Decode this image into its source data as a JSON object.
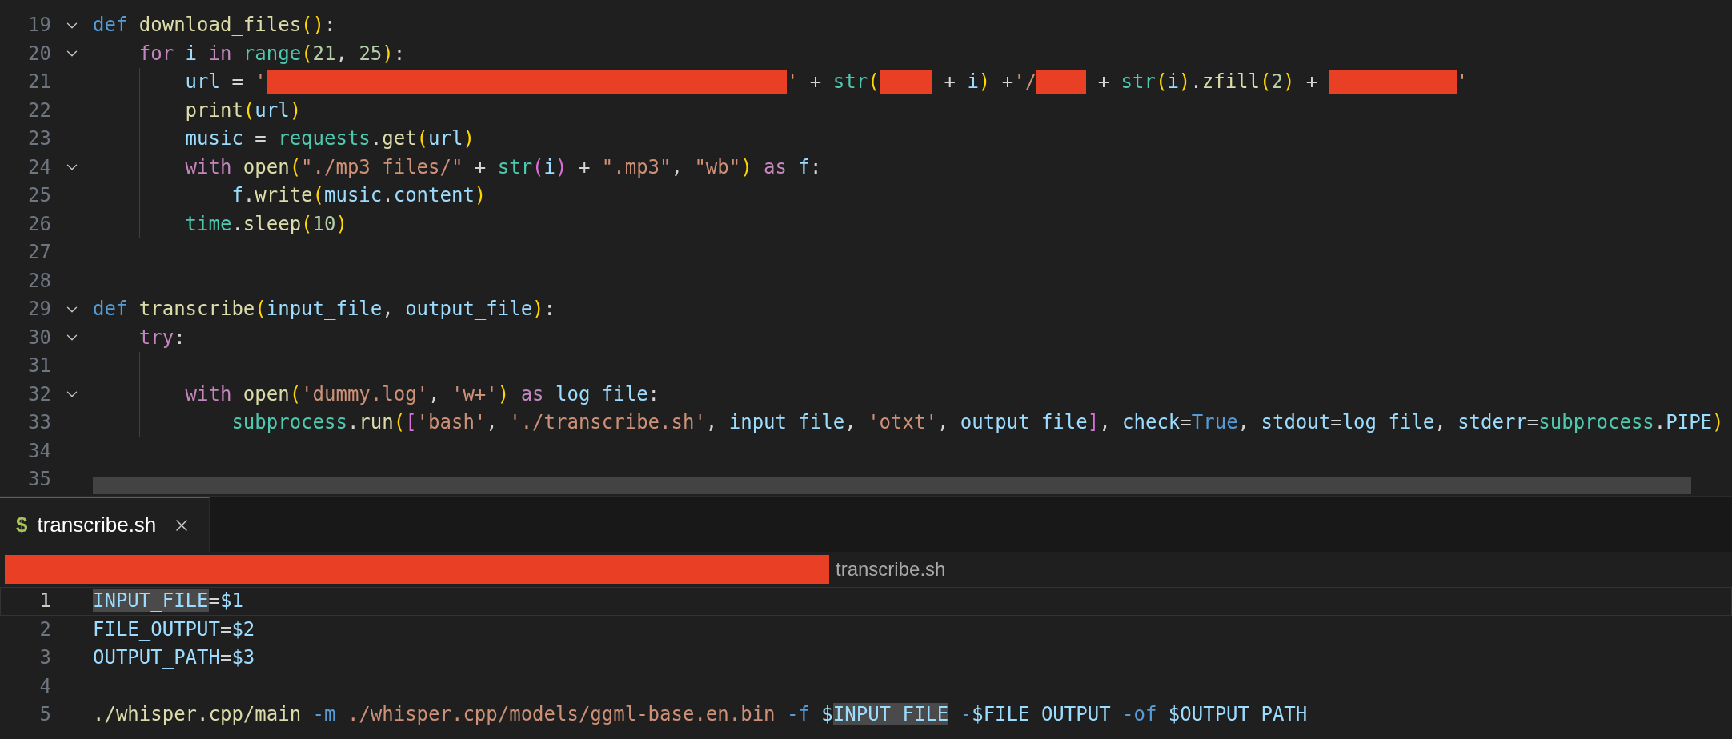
{
  "editor": {
    "lines": [
      {
        "n": "19",
        "fold": true,
        "current": false,
        "tokens": [
          {
            "kind": "storage",
            "text": "def"
          },
          {
            "kind": "function",
            "text": " download_files"
          },
          {
            "kind": "bracket1",
            "text": "()"
          },
          {
            "kind": "plain",
            "text": ":"
          }
        ],
        "children": [
          {
            "n": "20",
            "fold": true,
            "current": false,
            "tokens": [
              {
                "kind": "keyword",
                "text": "for"
              },
              {
                "kind": "variable",
                "text": " i"
              },
              {
                "kind": "keyword",
                "text": " in"
              },
              {
                "kind": "builtin",
                "text": " range"
              },
              {
                "kind": "bracket1",
                "text": "("
              },
              {
                "kind": "number",
                "text": "21"
              },
              {
                "kind": "plain",
                "text": ","
              },
              {
                "kind": "number",
                "text": " 25"
              },
              {
                "kind": "bracket1",
                "text": ")"
              },
              {
                "kind": "plain",
                "text": ":"
              }
            ],
            "children": [
              {
                "n": "21",
                "fold": false,
                "current": false,
                "tokens": [
                  {
                    "kind": "variable",
                    "text": "url"
                  },
                  {
                    "kind": "plain",
                    "text": " ="
                  },
                  {
                    "kind": "string",
                    "text": " '"
                  },
                  {
                    "kind": "redacted"
                  },
                  {
                    "kind": "string",
                    "text": "'"
                  },
                  {
                    "kind": "plain",
                    "text": " +"
                  },
                  {
                    "kind": "builtin",
                    "text": " str"
                  },
                  {
                    "kind": "bracket1",
                    "text": "("
                  },
                  {
                    "kind": "redacted"
                  },
                  {
                    "kind": "plain",
                    "text": " +"
                  },
                  {
                    "kind": "variable",
                    "text": " i"
                  },
                  {
                    "kind": "bracket1",
                    "text": ")"
                  },
                  {
                    "kind": "plain",
                    "text": " +"
                  },
                  {
                    "kind": "string",
                    "text": "'/"
                  },
                  {
                    "kind": "redacted"
                  },
                  {
                    "kind": "plain",
                    "text": " +"
                  },
                  {
                    "kind": "builtin",
                    "text": " str"
                  },
                  {
                    "kind": "bracket1",
                    "text": "("
                  },
                  {
                    "kind": "variable",
                    "text": "i"
                  },
                  {
                    "kind": "bracket1",
                    "text": ")"
                  },
                  {
                    "kind": "plain",
                    "text": "."
                  },
                  {
                    "kind": "function",
                    "text": "zfill"
                  },
                  {
                    "kind": "bracket1",
                    "text": "("
                  },
                  {
                    "kind": "number",
                    "text": "2"
                  },
                  {
                    "kind": "bracket1",
                    "text": ")"
                  },
                  {
                    "kind": "plain",
                    "text": " + "
                  },
                  {
                    "kind": "redacted"
                  },
                  {
                    "kind": "string",
                    "text": "'"
                  }
                ]
              },
              {
                "n": "22",
                "fold": false,
                "current": false,
                "tokens": [
                  {
                    "kind": "function",
                    "text": "print"
                  },
                  {
                    "kind": "bracket1",
                    "text": "("
                  },
                  {
                    "kind": "variable",
                    "text": "url"
                  },
                  {
                    "kind": "bracket1",
                    "text": ")"
                  }
                ]
              },
              {
                "n": "23",
                "fold": false,
                "current": false,
                "tokens": [
                  {
                    "kind": "variable",
                    "text": "music"
                  },
                  {
                    "kind": "plain",
                    "text": " ="
                  },
                  {
                    "kind": "builtin",
                    "text": " requests"
                  },
                  {
                    "kind": "plain",
                    "text": "."
                  },
                  {
                    "kind": "function",
                    "text": "get"
                  },
                  {
                    "kind": "bracket1",
                    "text": "("
                  },
                  {
                    "kind": "variable",
                    "text": "url"
                  },
                  {
                    "kind": "bracket1",
                    "text": ")"
                  }
                ]
              },
              {
                "n": "24",
                "fold": true,
                "current": false,
                "tokens": [
                  {
                    "kind": "keyword",
                    "text": "with"
                  },
                  {
                    "kind": "function",
                    "text": " open"
                  },
                  {
                    "kind": "bracket1",
                    "text": "("
                  },
                  {
                    "kind": "string",
                    "text": "\"./mp3_files/\""
                  },
                  {
                    "kind": "plain",
                    "text": " +"
                  },
                  {
                    "kind": "builtin",
                    "text": " str"
                  },
                  {
                    "kind": "bracket2",
                    "text": "("
                  },
                  {
                    "kind": "variable",
                    "text": "i"
                  },
                  {
                    "kind": "bracket2",
                    "text": ")"
                  },
                  {
                    "kind": "plain",
                    "text": " +"
                  },
                  {
                    "kind": "string",
                    "text": " \".mp3\""
                  },
                  {
                    "kind": "plain",
                    "text": ","
                  },
                  {
                    "kind": "string",
                    "text": " \"wb\""
                  },
                  {
                    "kind": "bracket1",
                    "text": ")"
                  },
                  {
                    "kind": "keyword",
                    "text": " as"
                  },
                  {
                    "kind": "variable",
                    "text": " f"
                  },
                  {
                    "kind": "plain",
                    "text": ":"
                  }
                ],
                "children": [
                  {
                    "n": "25",
                    "fold": false,
                    "current": false,
                    "tokens": [
                      {
                        "kind": "variable",
                        "text": "f"
                      },
                      {
                        "kind": "plain",
                        "text": "."
                      },
                      {
                        "kind": "function",
                        "text": "write"
                      },
                      {
                        "kind": "bracket1",
                        "text": "("
                      },
                      {
                        "kind": "variable",
                        "text": "music"
                      },
                      {
                        "kind": "plain",
                        "text": "."
                      },
                      {
                        "kind": "variable",
                        "text": "content"
                      },
                      {
                        "kind": "bracket1",
                        "text": ")"
                      }
                    ]
                  }
                ]
              },
              {
                "n": "26",
                "fold": false,
                "current": false,
                "tokens": [
                  {
                    "kind": "builtin",
                    "text": "time"
                  },
                  {
                    "kind": "plain",
                    "text": "."
                  },
                  {
                    "kind": "function",
                    "text": "sleep"
                  },
                  {
                    "kind": "bracket1",
                    "text": "("
                  },
                  {
                    "kind": "number",
                    "text": "10"
                  },
                  {
                    "kind": "bracket1",
                    "text": ")"
                  }
                ]
              }
            ]
          }
        ]
      },
      {
        "n": "27",
        "fold": false,
        "current": false
      },
      {
        "n": "28",
        "fold": false,
        "current": false
      },
      {
        "n": "29",
        "fold": true,
        "current": false,
        "tokens": [
          {
            "kind": "storage",
            "text": "def"
          },
          {
            "kind": "function",
            "text": " transcribe"
          },
          {
            "kind": "bracket1",
            "text": "("
          },
          {
            "kind": "variable",
            "text": "input_file"
          },
          {
            "kind": "plain",
            "text": ","
          },
          {
            "kind": "variable",
            "text": " output_file"
          },
          {
            "kind": "bracket1",
            "text": ")"
          },
          {
            "kind": "plain",
            "text": ":"
          }
        ],
        "children": [
          {
            "n": "30",
            "fold": true,
            "current": false,
            "tokens": [
              {
                "kind": "keyword",
                "text": "try"
              },
              {
                "kind": "plain",
                "text": ":"
              }
            ],
            "children": [
              {
                "n": "31",
                "fold": false,
                "current": false
              },
              {
                "n": "32",
                "fold": true,
                "current": false,
                "tokens": [
                  {
                    "kind": "keyword",
                    "text": "with"
                  },
                  {
                    "kind": "function",
                    "text": " open"
                  },
                  {
                    "kind": "bracket1",
                    "text": "("
                  },
                  {
                    "kind": "string",
                    "text": "'dummy.log'"
                  },
                  {
                    "kind": "plain",
                    "text": ","
                  },
                  {
                    "kind": "string",
                    "text": " 'w+'"
                  },
                  {
                    "kind": "bracket1",
                    "text": ")"
                  },
                  {
                    "kind": "keyword",
                    "text": " as"
                  },
                  {
                    "kind": "variable",
                    "text": " log_file"
                  },
                  {
                    "kind": "plain",
                    "text": ":"
                  }
                ],
                "children": [
                  {
                    "n": "33",
                    "fold": false,
                    "current": false,
                    "tokens": [
                      {
                        "kind": "builtin",
                        "text": "subprocess"
                      },
                      {
                        "kind": "plain",
                        "text": "."
                      },
                      {
                        "kind": "function",
                        "text": "run"
                      },
                      {
                        "kind": "bracket1",
                        "text": "("
                      },
                      {
                        "kind": "bracket2",
                        "text": "["
                      },
                      {
                        "kind": "string",
                        "text": "'bash'"
                      },
                      {
                        "kind": "plain",
                        "text": ","
                      },
                      {
                        "kind": "string",
                        "text": " './transcribe.sh'"
                      },
                      {
                        "kind": "plain",
                        "text": ","
                      },
                      {
                        "kind": "variable",
                        "text": " input_file"
                      },
                      {
                        "kind": "plain",
                        "text": ","
                      },
                      {
                        "kind": "string",
                        "text": " 'otxt'"
                      },
                      {
                        "kind": "plain",
                        "text": ","
                      },
                      {
                        "kind": "variable",
                        "text": " output_file"
                      },
                      {
                        "kind": "bracket2",
                        "text": "]"
                      },
                      {
                        "kind": "plain",
                        "text": ","
                      },
                      {
                        "kind": "variable",
                        "text": " check"
                      },
                      {
                        "kind": "plain",
                        "text": "="
                      },
                      {
                        "kind": "storage",
                        "text": "True"
                      },
                      {
                        "kind": "plain",
                        "text": ","
                      },
                      {
                        "kind": "variable",
                        "text": " stdout"
                      },
                      {
                        "kind": "plain",
                        "text": "="
                      },
                      {
                        "kind": "variable",
                        "text": "log_file"
                      },
                      {
                        "kind": "plain",
                        "text": ","
                      },
                      {
                        "kind": "variable",
                        "text": " stderr"
                      },
                      {
                        "kind": "plain",
                        "text": "="
                      },
                      {
                        "kind": "builtin",
                        "text": "subprocess"
                      },
                      {
                        "kind": "plain",
                        "text": "."
                      },
                      {
                        "kind": "variable",
                        "text": "PIPE"
                      },
                      {
                        "kind": "bracket1",
                        "text": ")"
                      }
                    ]
                  }
                ]
              }
            ]
          },
          {
            "n": "34",
            "fold": false,
            "current": false
          }
        ]
      },
      {
        "n": "35",
        "fold": false,
        "current": false
      }
    ]
  },
  "tab": {
    "icon": "$",
    "label": "transcribe.sh",
    "selected": true
  },
  "breadcrumb": [
    {
      "kind": "redacted"
    },
    {
      "kind": "text",
      "text": "transcribe.sh"
    }
  ],
  "script_editor": {
    "lines": [
      {
        "n": "1",
        "fold": false,
        "current": true,
        "tokens": [
          {
            "kind": "match",
            "text": "INPUT_FILE"
          },
          {
            "kind": "plain",
            "text": "="
          },
          {
            "kind": "variable",
            "text": "$1"
          }
        ]
      },
      {
        "n": "2",
        "fold": false,
        "current": false,
        "tokens": [
          {
            "kind": "variable",
            "text": "FILE_OUTPUT"
          },
          {
            "kind": "plain",
            "text": "="
          },
          {
            "kind": "variable",
            "text": "$2"
          }
        ]
      },
      {
        "n": "3",
        "fold": false,
        "current": false,
        "tokens": [
          {
            "kind": "variable",
            "text": "OUTPUT_PATH"
          },
          {
            "kind": "plain",
            "text": "="
          },
          {
            "kind": "variable",
            "text": "$3"
          }
        ]
      },
      {
        "n": "4",
        "fold": false,
        "current": false
      },
      {
        "n": "5",
        "fold": false,
        "current": false,
        "tokens": [
          {
            "kind": "function",
            "text": "./whisper.cpp/main"
          },
          {
            "kind": "storage",
            "text": " -m"
          },
          {
            "kind": "string",
            "text": " ./whisper.cpp/models/ggml-base.en.bin"
          },
          {
            "kind": "storage",
            "text": " -f"
          },
          {
            "kind": "variable",
            "text": " $"
          },
          {
            "kind": "match",
            "text": "INPUT_FILE"
          },
          {
            "kind": "storage",
            "text": " -"
          },
          {
            "kind": "variable",
            "text": "$FILE_OUTPUT"
          },
          {
            "kind": "storage",
            "text": " -of"
          },
          {
            "kind": "variable",
            "text": " $OUTPUT_PATH"
          }
        ]
      }
    ]
  }
}
